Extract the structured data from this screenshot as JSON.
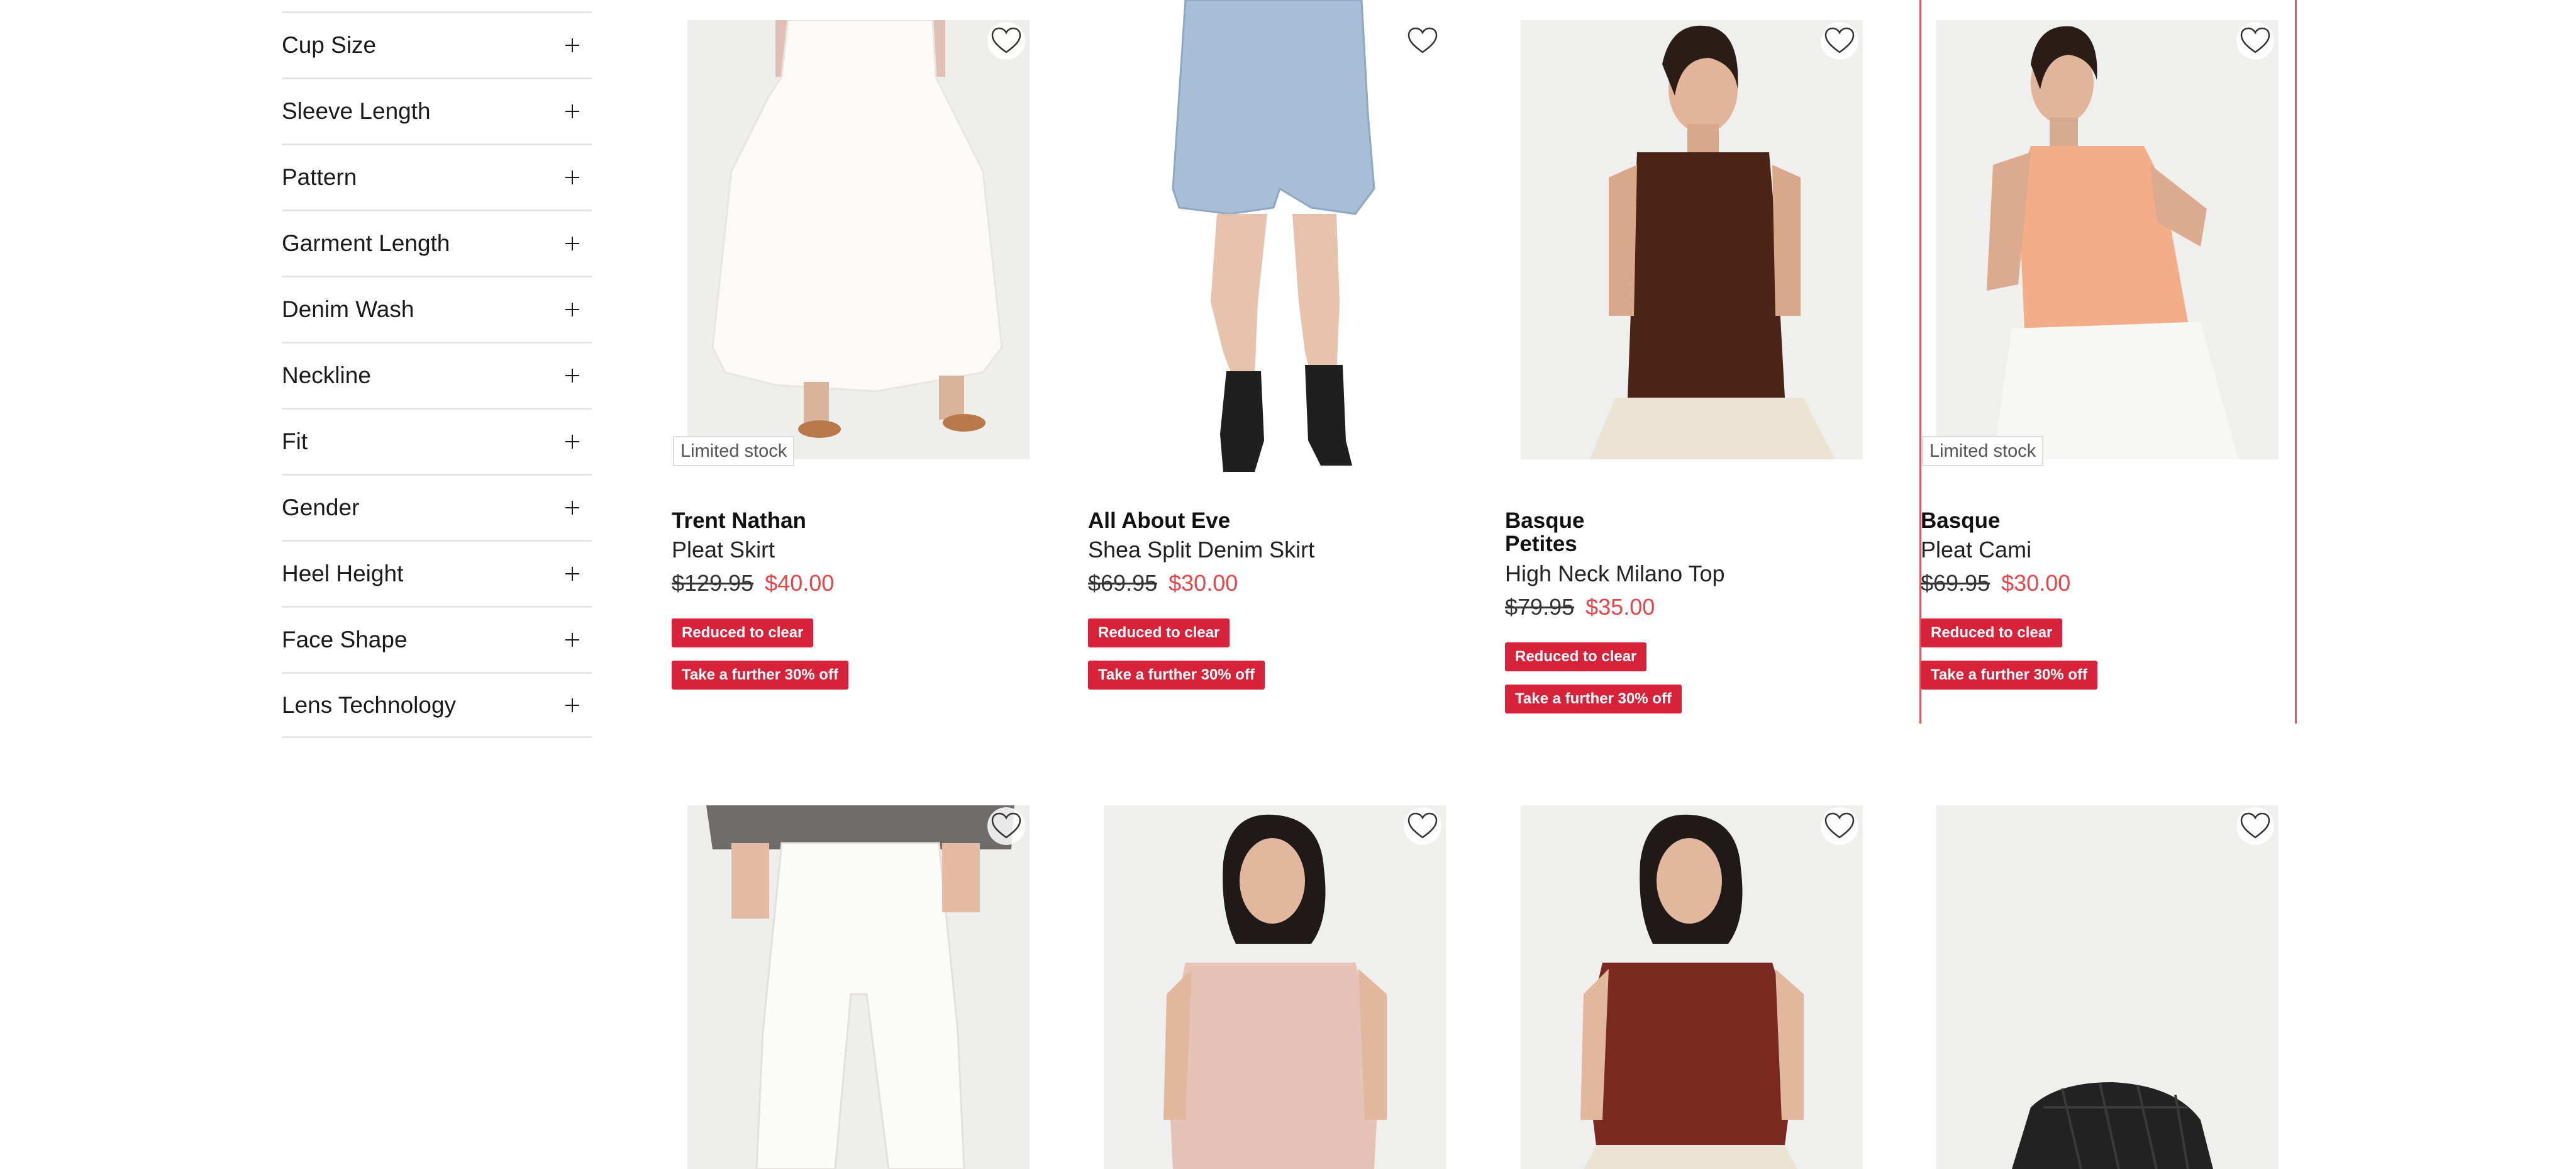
{
  "filters": [
    {
      "label": "Cup Size"
    },
    {
      "label": "Sleeve Length"
    },
    {
      "label": "Pattern"
    },
    {
      "label": "Garment Length"
    },
    {
      "label": "Denim Wash"
    },
    {
      "label": "Neckline"
    },
    {
      "label": "Fit"
    },
    {
      "label": "Gender"
    },
    {
      "label": "Heel Height"
    },
    {
      "label": "Face Shape"
    },
    {
      "label": "Lens Technology"
    }
  ],
  "products": [
    {
      "brand": "Trent Nathan",
      "name": "Pleat Skirt",
      "was_price": "$129.95",
      "now_price": "$40.00",
      "stock_label": "Limited stock",
      "promo_1": "Reduced to clear",
      "promo_2": "Take a further 30% off"
    },
    {
      "brand": "All About Eve",
      "name": "Shea Split Denim Skirt",
      "was_price": "$69.95",
      "now_price": "$30.00",
      "promo_1": "Reduced to clear",
      "promo_2": "Take a further 30% off"
    },
    {
      "brand": "Basque",
      "sub_brand": "Petites",
      "name": "High Neck Milano Top",
      "was_price": "$79.95",
      "now_price": "$35.00",
      "promo_1": "Reduced to clear",
      "promo_2": "Take a further 30% off"
    },
    {
      "brand": "Basque",
      "name": "Pleat Cami",
      "was_price": "$69.95",
      "now_price": "$30.00",
      "stock_label": "Limited stock",
      "promo_1": "Reduced to clear",
      "promo_2": "Take a further 30% off"
    }
  ],
  "colors": {
    "accent_price": "#e8454b",
    "promo_badge": "#d8223a",
    "selected_outline": "#e8555a"
  },
  "icons": [
    "plus-icon",
    "heart-icon"
  ]
}
